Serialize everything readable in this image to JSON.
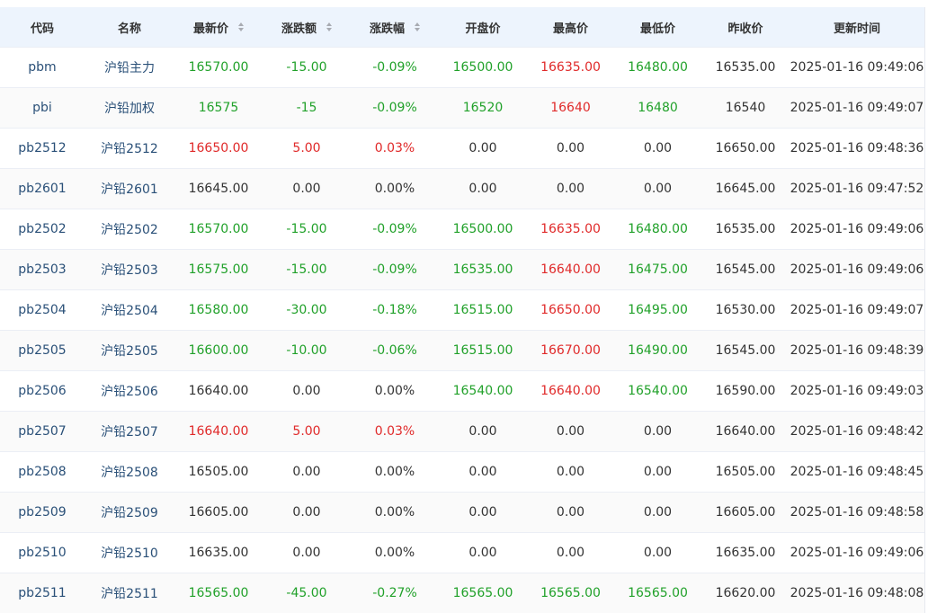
{
  "headers": [
    {
      "label": "代码",
      "sortable": false
    },
    {
      "label": "名称",
      "sortable": false
    },
    {
      "label": "最新价",
      "sortable": true
    },
    {
      "label": "涨跌额",
      "sortable": true
    },
    {
      "label": "涨跌幅",
      "sortable": true
    },
    {
      "label": "开盘价",
      "sortable": false
    },
    {
      "label": "最高价",
      "sortable": false
    },
    {
      "label": "最低价",
      "sortable": false
    },
    {
      "label": "昨收价",
      "sortable": false
    },
    {
      "label": "更新时间",
      "sortable": false
    }
  ],
  "colors": {
    "up": "#e02a2a",
    "down": "#21a12a",
    "link": "#2a5078",
    "header_bg": "#edf4fd"
  },
  "rows": [
    {
      "code": "pbm",
      "name": "沪铅主力",
      "last": "16570.00",
      "last_dir": "down",
      "chg": "-15.00",
      "chg_dir": "down",
      "pct": "-0.09%",
      "pct_dir": "down",
      "open": "16500.00",
      "open_dir": "down",
      "high": "16635.00",
      "high_dir": "up",
      "low": "16480.00",
      "low_dir": "down",
      "prev": "16535.00",
      "time": "2025-01-16 09:49:06"
    },
    {
      "code": "pbi",
      "name": "沪铅加权",
      "last": "16575",
      "last_dir": "down",
      "chg": "-15",
      "chg_dir": "down",
      "pct": "-0.09%",
      "pct_dir": "down",
      "open": "16520",
      "open_dir": "down",
      "high": "16640",
      "high_dir": "up",
      "low": "16480",
      "low_dir": "down",
      "prev": "16540",
      "time": "2025-01-16 09:49:07"
    },
    {
      "code": "pb2512",
      "name": "沪铅2512",
      "last": "16650.00",
      "last_dir": "up",
      "chg": "5.00",
      "chg_dir": "up",
      "pct": "0.03%",
      "pct_dir": "up",
      "open": "0.00",
      "open_dir": "flat",
      "high": "0.00",
      "high_dir": "flat",
      "low": "0.00",
      "low_dir": "flat",
      "prev": "16650.00",
      "time": "2025-01-16 09:48:36"
    },
    {
      "code": "pb2601",
      "name": "沪铅2601",
      "last": "16645.00",
      "last_dir": "flat",
      "chg": "0.00",
      "chg_dir": "flat",
      "pct": "0.00%",
      "pct_dir": "flat",
      "open": "0.00",
      "open_dir": "flat",
      "high": "0.00",
      "high_dir": "flat",
      "low": "0.00",
      "low_dir": "flat",
      "prev": "16645.00",
      "time": "2025-01-16 09:47:52"
    },
    {
      "code": "pb2502",
      "name": "沪铅2502",
      "last": "16570.00",
      "last_dir": "down",
      "chg": "-15.00",
      "chg_dir": "down",
      "pct": "-0.09%",
      "pct_dir": "down",
      "open": "16500.00",
      "open_dir": "down",
      "high": "16635.00",
      "high_dir": "up",
      "low": "16480.00",
      "low_dir": "down",
      "prev": "16535.00",
      "time": "2025-01-16 09:49:06"
    },
    {
      "code": "pb2503",
      "name": "沪铅2503",
      "last": "16575.00",
      "last_dir": "down",
      "chg": "-15.00",
      "chg_dir": "down",
      "pct": "-0.09%",
      "pct_dir": "down",
      "open": "16535.00",
      "open_dir": "down",
      "high": "16640.00",
      "high_dir": "up",
      "low": "16475.00",
      "low_dir": "down",
      "prev": "16545.00",
      "time": "2025-01-16 09:49:06"
    },
    {
      "code": "pb2504",
      "name": "沪铅2504",
      "last": "16580.00",
      "last_dir": "down",
      "chg": "-30.00",
      "chg_dir": "down",
      "pct": "-0.18%",
      "pct_dir": "down",
      "open": "16515.00",
      "open_dir": "down",
      "high": "16650.00",
      "high_dir": "up",
      "low": "16495.00",
      "low_dir": "down",
      "prev": "16530.00",
      "time": "2025-01-16 09:49:07"
    },
    {
      "code": "pb2505",
      "name": "沪铅2505",
      "last": "16600.00",
      "last_dir": "down",
      "chg": "-10.00",
      "chg_dir": "down",
      "pct": "-0.06%",
      "pct_dir": "down",
      "open": "16515.00",
      "open_dir": "down",
      "high": "16670.00",
      "high_dir": "up",
      "low": "16490.00",
      "low_dir": "down",
      "prev": "16545.00",
      "time": "2025-01-16 09:48:39"
    },
    {
      "code": "pb2506",
      "name": "沪铅2506",
      "last": "16640.00",
      "last_dir": "flat",
      "chg": "0.00",
      "chg_dir": "flat",
      "pct": "0.00%",
      "pct_dir": "flat",
      "open": "16540.00",
      "open_dir": "down",
      "high": "16640.00",
      "high_dir": "up",
      "low": "16540.00",
      "low_dir": "down",
      "prev": "16590.00",
      "time": "2025-01-16 09:49:03"
    },
    {
      "code": "pb2507",
      "name": "沪铅2507",
      "last": "16640.00",
      "last_dir": "up",
      "chg": "5.00",
      "chg_dir": "up",
      "pct": "0.03%",
      "pct_dir": "up",
      "open": "0.00",
      "open_dir": "flat",
      "high": "0.00",
      "high_dir": "flat",
      "low": "0.00",
      "low_dir": "flat",
      "prev": "16640.00",
      "time": "2025-01-16 09:48:42"
    },
    {
      "code": "pb2508",
      "name": "沪铅2508",
      "last": "16505.00",
      "last_dir": "flat",
      "chg": "0.00",
      "chg_dir": "flat",
      "pct": "0.00%",
      "pct_dir": "flat",
      "open": "0.00",
      "open_dir": "flat",
      "high": "0.00",
      "high_dir": "flat",
      "low": "0.00",
      "low_dir": "flat",
      "prev": "16505.00",
      "time": "2025-01-16 09:48:45"
    },
    {
      "code": "pb2509",
      "name": "沪铅2509",
      "last": "16605.00",
      "last_dir": "flat",
      "chg": "0.00",
      "chg_dir": "flat",
      "pct": "0.00%",
      "pct_dir": "flat",
      "open": "0.00",
      "open_dir": "flat",
      "high": "0.00",
      "high_dir": "flat",
      "low": "0.00",
      "low_dir": "flat",
      "prev": "16605.00",
      "time": "2025-01-16 09:48:58"
    },
    {
      "code": "pb2510",
      "name": "沪铅2510",
      "last": "16635.00",
      "last_dir": "flat",
      "chg": "0.00",
      "chg_dir": "flat",
      "pct": "0.00%",
      "pct_dir": "flat",
      "open": "0.00",
      "open_dir": "flat",
      "high": "0.00",
      "high_dir": "flat",
      "low": "0.00",
      "low_dir": "flat",
      "prev": "16635.00",
      "time": "2025-01-16 09:49:06"
    },
    {
      "code": "pb2511",
      "name": "沪铅2511",
      "last": "16565.00",
      "last_dir": "down",
      "chg": "-45.00",
      "chg_dir": "down",
      "pct": "-0.27%",
      "pct_dir": "down",
      "open": "16565.00",
      "open_dir": "down",
      "high": "16565.00",
      "high_dir": "down",
      "low": "16565.00",
      "low_dir": "down",
      "prev": "16620.00",
      "time": "2025-01-16 09:48:08"
    }
  ]
}
